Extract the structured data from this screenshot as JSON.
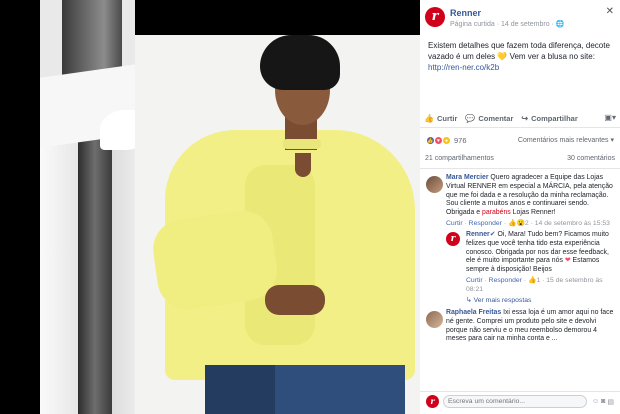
{
  "post": {
    "page_name": "Renner",
    "page_meta": "Página curtida · 14 de setembro · ",
    "text": "Existem detalhes que fazem toda diferença, decote vazado é um deles ",
    "text_after_emoji": " Vem ver a blusa no site:",
    "link": "http://ren-ner.co/k2b",
    "logo_letter": "r"
  },
  "actions": {
    "like": "Curtir",
    "comment": "Comentar",
    "share": "Compartilhar"
  },
  "reactions": {
    "count": "976",
    "order": "Comentários mais relevantes ▾"
  },
  "counts": {
    "shares": "21 compartilhamentos",
    "comments": "30 comentários"
  },
  "comments": [
    {
      "author": "Mara Mercier",
      "text": " Quero agradecer a Equipe das Lojas Virtual RENNER em especial a MÁRCIA, pela atenção que me foi dada e a resolução da minha reclamação. Sou cliente a muitos anos e continuarei sendo. Obrigada e ",
      "highlight": "parabéns",
      "text_end": " Lojas Renner!",
      "meta_like": "Curtir",
      "meta_reply": "Responder",
      "meta_reacts": "2",
      "meta_date": "14 de setembro às 15:53",
      "reply": {
        "author": "Renner",
        "text": " Oi, Mara! Tudo bem? Ficamos muito felizes que você tenha tido esta experiência conosco. Obrigada por nos dar esse feedback, ele é muito importante para nós ",
        "text_end": " Estamos sempre à disposição! Beijos",
        "meta_like": "Curtir",
        "meta_reply": "Responder",
        "meta_reacts": "1",
        "meta_date": "15 de setembro às 08:21"
      },
      "more_replies": "↳ Ver mais respostas"
    },
    {
      "author": "Raphaela Freitas",
      "text": " Ixi essa loja é um amor aqui no face né gente. Comprei um produto pelo site e devolvi porque não serviu e o meu reembolso demorou 4 meses para cair na minha conta e ..."
    }
  ],
  "composer": {
    "placeholder": "Escreva um comentário..."
  },
  "colors": {
    "brand": "#d0021b",
    "link": "#365899",
    "blouse": "#f1ef86"
  }
}
